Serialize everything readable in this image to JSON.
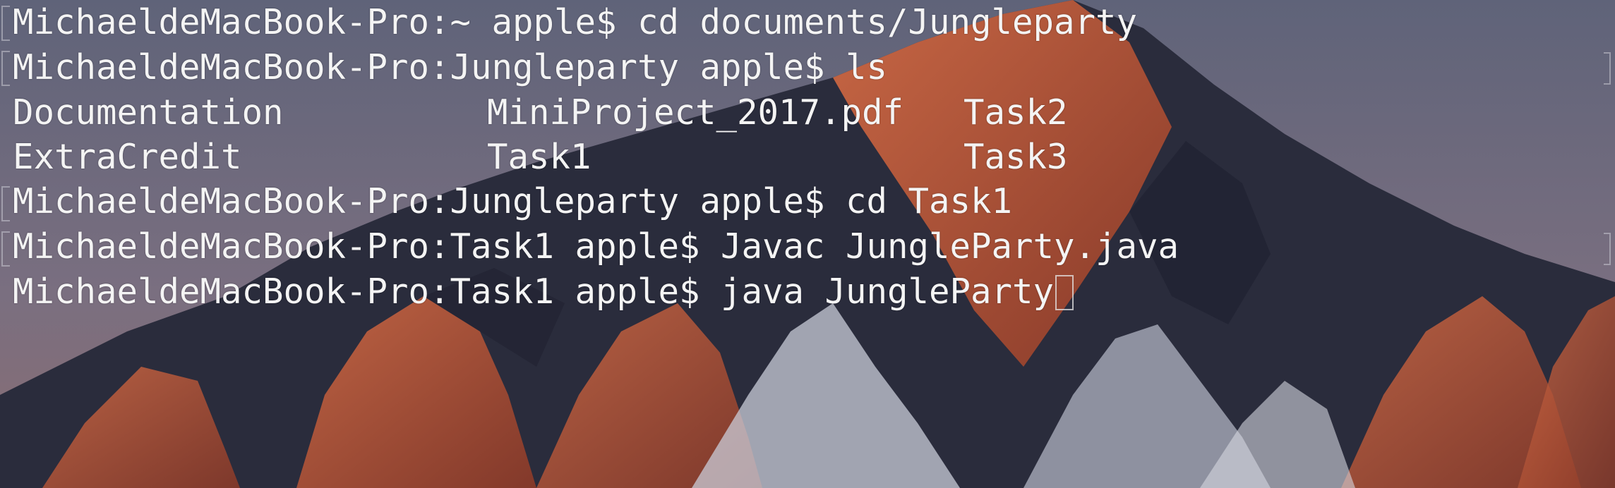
{
  "terminal": {
    "lines": [
      "MichaeldeMacBook-Pro:~ apple$ cd documents/Jungleparty",
      "MichaeldeMacBook-Pro:Jungleparty apple$ ls",
      "MichaeldeMacBook-Pro:Jungleparty apple$ cd Task1",
      "MichaeldeMacBook-Pro:Task1 apple$ Javac JungleParty.java",
      "MichaeldeMacBook-Pro:Task1 apple$ java JungleParty"
    ],
    "ls_output": {
      "row1": [
        "Documentation",
        "MiniProject_2017.pdf",
        "Task2"
      ],
      "row2": [
        "ExtraCredit",
        "Task1",
        "Task3"
      ]
    }
  },
  "colors": {
    "text": "#f4f4f4",
    "sky": "#6b6f85",
    "rock_orange": "#c0583a",
    "snow": "#c9ccd8",
    "shadow": "#1f2130"
  },
  "icons": [
    "cursor-block-icon"
  ]
}
